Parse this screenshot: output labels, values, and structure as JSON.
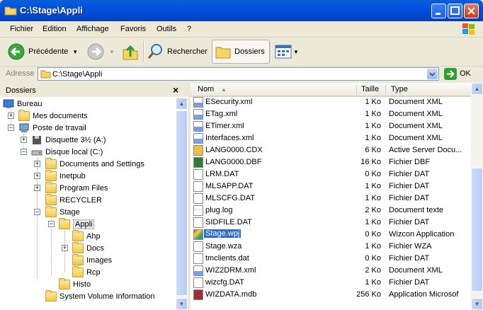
{
  "window": {
    "title": "C:\\Stage\\Appli"
  },
  "menu": [
    "Fichier",
    "Edition",
    "Affichage",
    "Favoris",
    "Outils",
    "?"
  ],
  "toolbar": {
    "back": "Précédente",
    "search": "Rechercher",
    "folders": "Dossiers"
  },
  "address": {
    "label": "Adresse",
    "value": "C:\\Stage\\Appli",
    "go": "OK"
  },
  "folders_pane": {
    "title": "Dossiers",
    "close": "×",
    "tree": [
      {
        "label": "Bureau",
        "level": 0,
        "icon": "desktop-icon"
      },
      {
        "label": "Mes documents",
        "level": 1,
        "icon": "folder-icon",
        "expander": "+"
      },
      {
        "label": "Poste de travail",
        "level": 1,
        "icon": "computer-icon",
        "expander": "−"
      },
      {
        "label": "Disquette 3½ (A:)",
        "level": 2,
        "icon": "floppy-icon",
        "expander": "+"
      },
      {
        "label": "Disque local (C:)",
        "level": 2,
        "icon": "drive-icon",
        "expander": "−"
      },
      {
        "label": "Documents and Settings",
        "level": 3,
        "icon": "folder-icon",
        "expander": "+"
      },
      {
        "label": "Inetpub",
        "level": 3,
        "icon": "folder-icon",
        "expander": "+"
      },
      {
        "label": "Program Files",
        "level": 3,
        "icon": "folder-icon",
        "expander": "+"
      },
      {
        "label": "RECYCLER",
        "level": 3,
        "icon": "folder-icon"
      },
      {
        "label": "Stage",
        "level": 3,
        "icon": "folder-icon",
        "expander": "−"
      },
      {
        "label": "Appli",
        "level": 4,
        "icon": "folder-open-icon",
        "expander": "−",
        "selected": true
      },
      {
        "label": "Ahp",
        "level": 5,
        "icon": "folder-icon"
      },
      {
        "label": "Docs",
        "level": 5,
        "icon": "folder-icon",
        "expander": "+"
      },
      {
        "label": "Images",
        "level": 5,
        "icon": "folder-icon"
      },
      {
        "label": "Rcp",
        "level": 5,
        "icon": "folder-icon"
      },
      {
        "label": "Histo",
        "level": 4,
        "icon": "folder-icon"
      },
      {
        "label": "System Volume Information",
        "level": 3,
        "icon": "folder-icon"
      }
    ]
  },
  "files_pane": {
    "columns": {
      "name": "Nom",
      "size": "Taille",
      "type": "Type"
    },
    "rows": [
      {
        "name": "ESecurity.xml",
        "size": "1 Ko",
        "type": "Document XML",
        "icon": "xml-file-icon"
      },
      {
        "name": "ETag.xml",
        "size": "1 Ko",
        "type": "Document XML",
        "icon": "xml-file-icon"
      },
      {
        "name": "ETimer.xml",
        "size": "1 Ko",
        "type": "Document XML",
        "icon": "xml-file-icon"
      },
      {
        "name": "Interfaces.xml",
        "size": "1 Ko",
        "type": "Document XML",
        "icon": "xml-file-icon"
      },
      {
        "name": "LANG0000.CDX",
        "size": "6 Ko",
        "type": "Active Server Docu...",
        "icon": "cdx-file-icon"
      },
      {
        "name": "LANG0000.DBF",
        "size": "16 Ko",
        "type": "Fichier DBF",
        "icon": "dbf-file-icon"
      },
      {
        "name": "LRM.DAT",
        "size": "0 Ko",
        "type": "Fichier DAT",
        "icon": "dat-file-icon"
      },
      {
        "name": "MLSAPP.DAT",
        "size": "1 Ko",
        "type": "Fichier DAT",
        "icon": "dat-file-icon"
      },
      {
        "name": "MLSCFG.DAT",
        "size": "1 Ko",
        "type": "Fichier DAT",
        "icon": "dat-file-icon"
      },
      {
        "name": "plug.log",
        "size": "2 Ko",
        "type": "Document texte",
        "icon": "text-file-icon"
      },
      {
        "name": "SIDFILE.DAT",
        "size": "1 Ko",
        "type": "Fichier DAT",
        "icon": "dat-file-icon"
      },
      {
        "name": "Stage.wpj",
        "size": "0 Ko",
        "type": "Wizcon Application",
        "icon": "wizcon-file-icon",
        "selected": true
      },
      {
        "name": "Stage.wza",
        "size": "1 Ko",
        "type": "Fichier WZA",
        "icon": "dat-file-icon"
      },
      {
        "name": "tmclients.dat",
        "size": "0 Ko",
        "type": "Fichier DAT",
        "icon": "dat-file-icon"
      },
      {
        "name": "WIZ2DRM.xml",
        "size": "2 Ko",
        "type": "Document XML",
        "icon": "xml-file-icon"
      },
      {
        "name": "wizcfg.DAT",
        "size": "1 Ko",
        "type": "Fichier DAT",
        "icon": "dat-file-icon"
      },
      {
        "name": "WIZDATA.mdb",
        "size": "256 Ko",
        "type": "Application Microsof",
        "icon": "mdb-file-icon"
      }
    ]
  },
  "colors": {
    "title_bar": "#0050e0",
    "selection": "#316ac5",
    "chrome": "#ece9d8"
  }
}
